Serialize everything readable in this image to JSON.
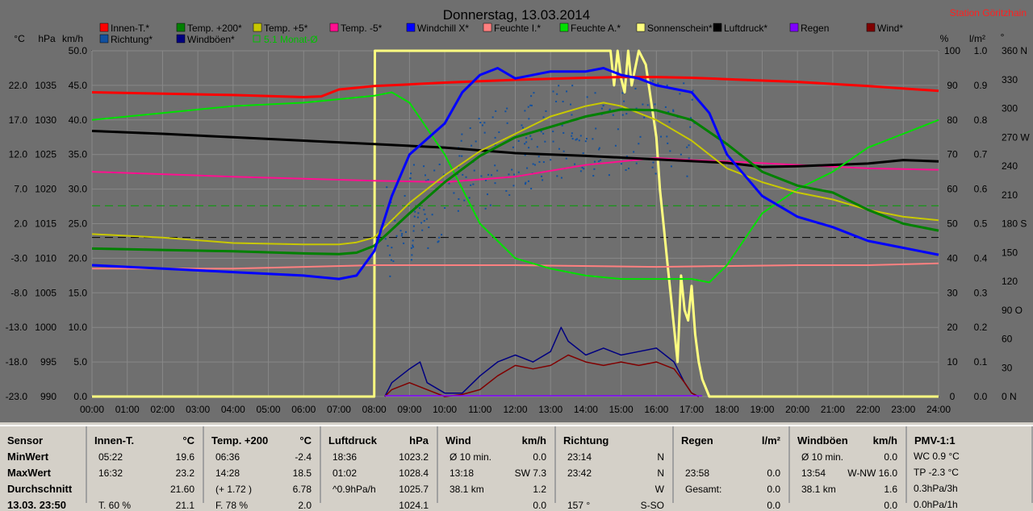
{
  "title": "Donnerstag, 13.03.2014",
  "station": "Station Göritzhain",
  "unit_labels": [
    "°C",
    "hPa",
    "km/h",
    "%",
    "l/m²",
    "°"
  ],
  "colors": {
    "bg": "#6f6f6f",
    "grid": "#8a8a8a",
    "accent_red": "#ff2020"
  },
  "chart_data": {
    "type": "line",
    "title": "Donnerstag, 13.03.2014",
    "grid": true,
    "legend_placement": "top",
    "x": [
      "00:00",
      "01:00",
      "02:00",
      "03:00",
      "04:00",
      "05:00",
      "06:00",
      "07:00",
      "08:00",
      "09:00",
      "10:00",
      "11:00",
      "12:00",
      "13:00",
      "14:00",
      "15:00",
      "16:00",
      "17:00",
      "18:00",
      "19:00",
      "20:00",
      "21:00",
      "22:00",
      "23:00",
      "24:00"
    ],
    "axes": {
      "temp_C": {
        "ticks": [
          "22.0",
          "17.0",
          "12.0",
          "7.0",
          "2.0",
          "-3.0",
          "-8.0",
          "-13.0",
          "-18.0",
          "-23.0"
        ],
        "range": [
          -23,
          27
        ]
      },
      "pressure_hPa": {
        "ticks": [
          "1035",
          "1030",
          "1025",
          "1020",
          "1015",
          "1010",
          "1005",
          "1000",
          "995",
          "990"
        ],
        "range": [
          990,
          1040
        ]
      },
      "speed_kmh": {
        "ticks": [
          "50.0",
          "45.0",
          "40.0",
          "35.0",
          "30.0",
          "25.0",
          "20.0",
          "15.0",
          "10.0",
          "5.0",
          "0.0"
        ],
        "range": [
          0,
          50
        ]
      },
      "percent": {
        "ticks": [
          "100",
          "90",
          "80",
          "70",
          "60",
          "50",
          "40",
          "30",
          "20",
          "10",
          "0"
        ],
        "range": [
          0,
          100
        ]
      },
      "rain_lm2": {
        "ticks": [
          "1.0",
          "0.9",
          "0.8",
          "0.7",
          "0.6",
          "0.5",
          "0.4",
          "0.3",
          "0.2",
          "0.1",
          "0.0"
        ],
        "range": [
          0,
          1
        ]
      },
      "direction_deg": {
        "ticks": [
          "360 N",
          "330",
          "300",
          "270 W",
          "240",
          "210",
          "180 S",
          "150",
          "120",
          "90 O",
          "60",
          "30",
          "0 N"
        ],
        "range": [
          0,
          360
        ]
      }
    },
    "legend": [
      {
        "name": "Innen-T.*",
        "color": "#ff0000"
      },
      {
        "name": "Temp. +200*",
        "color": "#008000"
      },
      {
        "name": "Temp. +5*",
        "color": "#c8c800"
      },
      {
        "name": "Temp. -5*",
        "color": "#ff1090"
      },
      {
        "name": "Windchill X*",
        "color": "#0000ff"
      },
      {
        "name": "Feuchte I.*",
        "color": "#ff8080"
      },
      {
        "name": "Feuchte A.*",
        "color": "#00e000"
      },
      {
        "name": "Sonnenschein*",
        "color": "#ffff80"
      },
      {
        "name": "Luftdruck*",
        "color": "#000000"
      },
      {
        "name": "Regen",
        "color": "#8000ff"
      },
      {
        "name": "Wind*",
        "color": "#800000"
      },
      {
        "name": "Richtung*",
        "color": "#1050a0"
      },
      {
        "name": "Windböen*",
        "color": "#000080"
      },
      {
        "name": "5.1 Monat-Ø",
        "color": "#00c000"
      }
    ],
    "series": [
      {
        "name": "Innen-T.*",
        "color": "#ff0000",
        "axis": "temp_C",
        "width": 3,
        "x": [
          0,
          4,
          6,
          6.5,
          7,
          8,
          10,
          12,
          14,
          15,
          16,
          17,
          18,
          20,
          22,
          24
        ],
        "values": [
          21.0,
          20.6,
          20.3,
          20.4,
          21.4,
          21.9,
          22.4,
          22.8,
          23.1,
          23.2,
          23.2,
          23.1,
          22.9,
          22.5,
          21.9,
          21.2
        ]
      },
      {
        "name": "Temp. +200*",
        "color": "#008000",
        "axis": "temp_C",
        "width": 3,
        "x": [
          0,
          2,
          4,
          6,
          7,
          7.5,
          8,
          9,
          10,
          11,
          12,
          13,
          14,
          15,
          16,
          17,
          18,
          19,
          20,
          21,
          22,
          23,
          24
        ],
        "values": [
          -1.6,
          -1.8,
          -2.0,
          -2.3,
          -2.4,
          -2.2,
          -1.2,
          3.5,
          8.0,
          11.8,
          14.5,
          16.0,
          17.5,
          18.5,
          18.4,
          17.0,
          13.5,
          9.5,
          7.5,
          6.5,
          4.0,
          2.0,
          1.0
        ]
      },
      {
        "name": "Temp. +5*",
        "color": "#c8c800",
        "axis": "temp_C",
        "width": 2,
        "x": [
          0,
          2,
          4,
          6,
          7,
          7.5,
          8,
          9,
          10,
          11,
          12,
          13,
          14,
          14.5,
          15,
          16,
          17,
          18,
          19,
          20,
          21,
          22,
          23,
          24
        ],
        "values": [
          0.5,
          0.0,
          -0.8,
          -1.0,
          -1.0,
          -0.7,
          0.0,
          5.0,
          9.0,
          12.5,
          15.0,
          17.5,
          19.0,
          19.5,
          19.0,
          17.0,
          14.0,
          10.0,
          8.0,
          6.5,
          5.5,
          4.0,
          3.0,
          2.5
        ]
      },
      {
        "name": "Temp. -5*",
        "color": "#ff1090",
        "axis": "temp_C",
        "width": 2,
        "x": [
          0,
          4,
          8,
          10,
          12,
          14,
          16,
          17,
          18,
          20,
          22,
          24
        ],
        "values": [
          9.5,
          8.8,
          8.2,
          8.0,
          8.8,
          10.5,
          11.5,
          11.2,
          11.0,
          10.5,
          10.0,
          9.8
        ]
      },
      {
        "name": "Windchill X*",
        "color": "#0000ff",
        "axis": "temp_C",
        "width": 3,
        "x": [
          0,
          2,
          4,
          6,
          7,
          7.5,
          8,
          8.5,
          9,
          10,
          10.5,
          11,
          11.5,
          12,
          13,
          14,
          14.5,
          15,
          15.5,
          16,
          17,
          17.5,
          18,
          19,
          20,
          21,
          22,
          23,
          24
        ],
        "values": [
          -4.0,
          -4.5,
          -5.0,
          -5.5,
          -6.0,
          -5.5,
          -2.0,
          6.0,
          12.0,
          16.5,
          21.0,
          23.5,
          24.5,
          23.0,
          24.0,
          24.0,
          24.5,
          23.5,
          23.0,
          22.0,
          21.0,
          18.0,
          12.0,
          6.0,
          3.0,
          1.5,
          -0.5,
          -1.5,
          -2.5
        ]
      },
      {
        "name": "Feuchte I.*",
        "color": "#ff8080",
        "axis": "percent",
        "width": 2,
        "x": [
          0,
          4,
          8,
          12,
          16,
          20,
          22,
          24
        ],
        "values": [
          37,
          37,
          38,
          38,
          37.5,
          38,
          38,
          38.5
        ]
      },
      {
        "name": "Feuchte A.*",
        "color": "#00e000",
        "axis": "percent",
        "width": 2,
        "x": [
          0,
          2,
          4,
          6,
          8,
          8.5,
          9,
          10,
          11,
          12,
          13,
          14,
          15,
          16,
          17,
          17.5,
          18,
          19,
          20,
          21,
          22,
          23,
          24
        ],
        "values": [
          80,
          82,
          84,
          85,
          87,
          88,
          85,
          70,
          50,
          40,
          37,
          35,
          34,
          34,
          34,
          33,
          38,
          53,
          60,
          65,
          72,
          76,
          80
        ]
      },
      {
        "name": "Luftdruck*",
        "color": "#000000",
        "axis": "pressure_hPa",
        "width": 3,
        "x": [
          0,
          2,
          4,
          6,
          8,
          10,
          12,
          14,
          16,
          18,
          19,
          20,
          22,
          23,
          24
        ],
        "values": [
          1028.4,
          1028.0,
          1027.5,
          1027.0,
          1026.5,
          1026.0,
          1025.2,
          1024.8,
          1024.3,
          1023.8,
          1023.2,
          1023.3,
          1023.7,
          1024.2,
          1024.0
        ]
      },
      {
        "name": "Sonnenschein*",
        "color": "#ffff80",
        "axis": "percent",
        "width": 3,
        "x": [
          0,
          8,
          8.02,
          14.7,
          14.8,
          14.9,
          15.0,
          15.1,
          15.2,
          15.3,
          15.5,
          15.7,
          16.0,
          16.1,
          16.2,
          16.3,
          16.4,
          16.5,
          16.6,
          16.7,
          16.8,
          16.9,
          17.0,
          17.1,
          17.2,
          17.3,
          17.5,
          24
        ],
        "values": [
          0,
          0,
          100,
          100,
          90,
          100,
          92,
          88,
          100,
          90,
          100,
          96,
          75,
          60,
          50,
          40,
          30,
          20,
          10,
          35,
          25,
          22,
          32,
          18,
          10,
          5,
          0,
          0
        ]
      },
      {
        "name": "Windböen*",
        "color": "#000080",
        "axis": "speed_kmh",
        "width": 1.5,
        "x": [
          8.3,
          8.5,
          9,
          9.3,
          9.5,
          10,
          10.5,
          11,
          11.5,
          12,
          12.5,
          13,
          13.3,
          13.5,
          14,
          14.5,
          15,
          15.5,
          16,
          16.5,
          16.8,
          17,
          17.2
        ],
        "values": [
          0,
          2,
          4,
          5,
          2,
          0.5,
          0.5,
          3,
          5,
          6,
          5,
          6.5,
          10,
          8,
          6,
          7,
          6,
          6.5,
          7,
          5,
          2,
          0.5,
          0
        ]
      },
      {
        "name": "Wind*",
        "color": "#800000",
        "axis": "speed_kmh",
        "width": 1.5,
        "x": [
          8.3,
          8.5,
          9,
          9.5,
          10,
          10.5,
          11,
          11.5,
          12,
          12.5,
          13,
          13.5,
          14,
          14.5,
          15,
          15.5,
          16,
          16.5,
          16.8,
          17,
          17.2
        ],
        "values": [
          0,
          1,
          2,
          1,
          0,
          0.3,
          1,
          3,
          4.5,
          4,
          4.5,
          6,
          5,
          4.5,
          5,
          4.5,
          5,
          4,
          2,
          0.5,
          0
        ]
      }
    ],
    "reference_lines": [
      {
        "name": "5.1 Monat-Ø",
        "axis": "temp_C",
        "value": 4.6,
        "color": "#00a000"
      },
      {
        "axis": "temp_C",
        "value": 0,
        "color": "#000000"
      }
    ]
  },
  "stats": {
    "sensor": {
      "header": "Sensor",
      "rows": [
        "MinWert",
        "MaxWert",
        "Durchschnitt",
        "13.03. 23:50"
      ]
    },
    "innen": {
      "header": "Innen-T.",
      "unit": "°C",
      "rows": [
        [
          "05:22",
          "19.6"
        ],
        [
          "16:32",
          "23.2"
        ],
        [
          "",
          "21.60"
        ],
        [
          "T. 60 %",
          "21.1"
        ]
      ]
    },
    "temp200": {
      "header": "Temp. +200",
      "unit": "°C",
      "rows": [
        [
          "06:36",
          "-2.4"
        ],
        [
          "14:28",
          "18.5"
        ],
        [
          "(+ 1.72 )",
          "6.78"
        ],
        [
          "F. 78 %",
          "2.0"
        ]
      ]
    },
    "luftdruck": {
      "header": "Luftdruck",
      "unit": "hPa",
      "rows": [
        [
          "18:36",
          "1023.2"
        ],
        [
          "01:02",
          "1028.4"
        ],
        [
          "^0.9hPa/h",
          "1025.7"
        ],
        [
          "",
          "1024.1"
        ]
      ]
    },
    "wind": {
      "header": "Wind",
      "unit": "km/h",
      "rows": [
        [
          "Ø 10 min.",
          "0.0"
        ],
        [
          "13:18",
          "SW 7.3"
        ],
        [
          "38.1 km",
          "1.2"
        ],
        [
          "",
          "0.0"
        ]
      ]
    },
    "richtung": {
      "header": "Richtung",
      "unit": "",
      "rows": [
        [
          "23:14",
          "N"
        ],
        [
          "23:42",
          "N"
        ],
        [
          "",
          "W"
        ],
        [
          "157 °",
          "S-SO"
        ]
      ]
    },
    "regen": {
      "header": "Regen",
      "unit": "l/m²",
      "rows": [
        [
          "",
          ""
        ],
        [
          "23:58",
          "0.0"
        ],
        [
          "Gesamt:",
          "0.0"
        ],
        [
          "",
          "0.0"
        ]
      ]
    },
    "boeen": {
      "header": "Windböen",
      "unit": "km/h",
      "rows": [
        [
          "Ø 10 min.",
          "0.0"
        ],
        [
          "13:54",
          "W-NW 16.0"
        ],
        [
          "38.1 km",
          "1.6"
        ],
        [
          "",
          "0.0"
        ]
      ]
    },
    "pmv": {
      "header": "PMV-1:1",
      "rows": [
        "WC 0.9 °C",
        "TP -2.3 °C",
        "0.3hPa/3h",
        "0.0hPa/1h"
      ]
    }
  }
}
